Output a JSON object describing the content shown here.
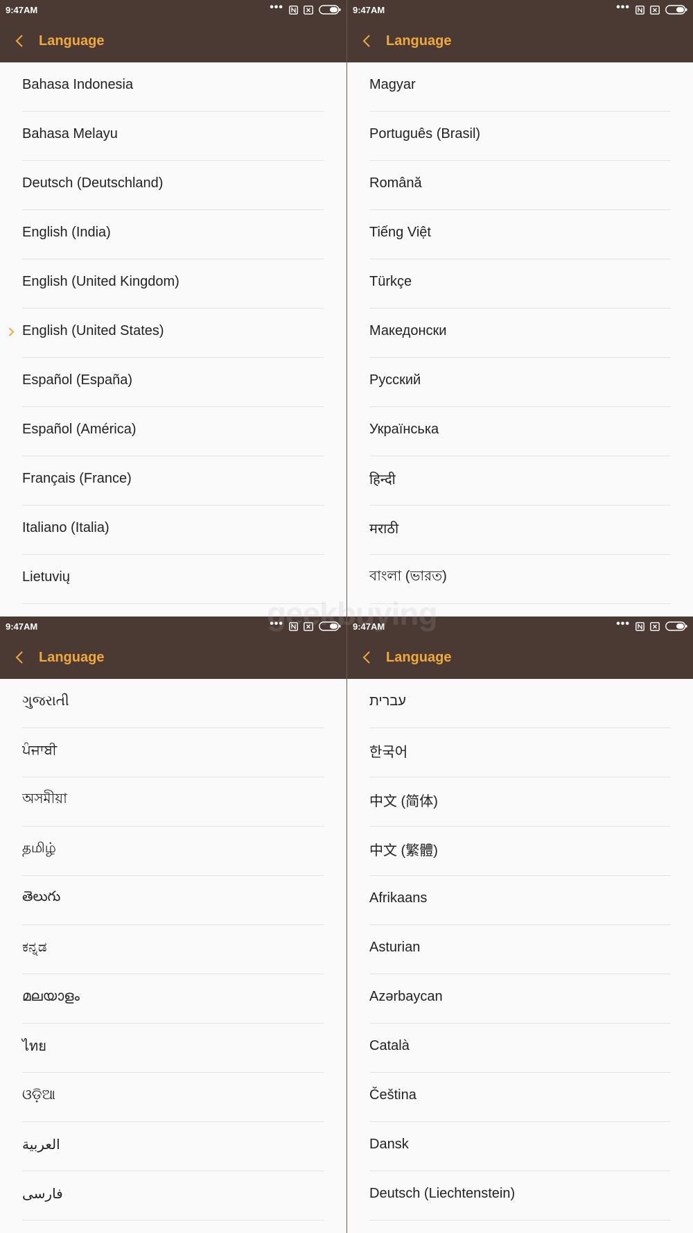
{
  "status_time": "9:47AM",
  "header_title": "Language",
  "selected_language": "English (United States)",
  "colors": {
    "app_bar": "#4a3a33",
    "accent": "#f2a93b",
    "background": "#fafafa"
  },
  "watermark": "geekbuying",
  "panels": [
    {
      "id": "tl",
      "items": [
        "Bahasa Indonesia",
        "Bahasa Melayu",
        "Deutsch (Deutschland)",
        "English (India)",
        "English (United Kingdom)",
        "English (United States)",
        "Español (España)",
        "Español (América)",
        "Français (France)",
        "Italiano (Italia)",
        "Lietuvių"
      ]
    },
    {
      "id": "tr",
      "items": [
        "Magyar",
        "Português (Brasil)",
        "Română",
        "Tiếng Việt",
        "Türkçe",
        "Македонски",
        "Русский",
        "Українська",
        "हिन्दी",
        "मराठी",
        "বাংলা (ভারত)"
      ]
    },
    {
      "id": "bl",
      "items": [
        "ગુજરાતી",
        "ਪੰਜਾਬੀ",
        "অসমীয়া",
        "தமிழ்",
        "తెలుగు",
        "ಕನ್ನಡ",
        "മലയാളം",
        "ไทย",
        "ଓଡ଼ିଆ",
        "العربية",
        "فارسی"
      ]
    },
    {
      "id": "br",
      "items": [
        "עברית",
        "한국어",
        "中文 (简体)",
        "中文 (繁體)",
        "Afrikaans",
        "Asturian",
        "Azərbaycan",
        "Català",
        "Čeština",
        "Dansk",
        "Deutsch (Liechtenstein)"
      ]
    }
  ]
}
